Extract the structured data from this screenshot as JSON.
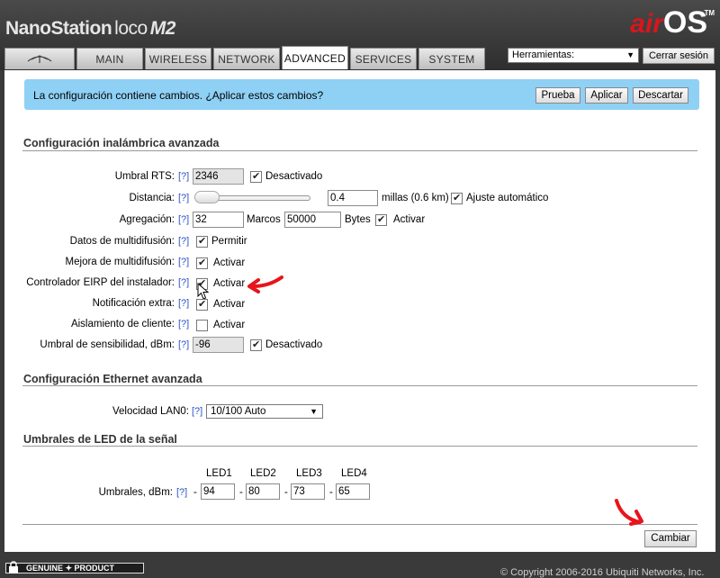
{
  "header": {
    "brand_main": "NanoStation",
    "brand_sub": "loco",
    "brand_model": "M2",
    "logo_air": "air",
    "logo_os": "OS",
    "logo_tm": "TM"
  },
  "tabs": [
    {
      "label": "",
      "icon": "ubiquiti-logo-icon"
    },
    {
      "label": "MAIN"
    },
    {
      "label": "WIRELESS"
    },
    {
      "label": "NETWORK"
    },
    {
      "label": "ADVANCED",
      "active": true
    },
    {
      "label": "SERVICES"
    },
    {
      "label": "SYSTEM"
    }
  ],
  "tools": {
    "selected": "Herramientas:",
    "logout": "Cerrar sesión"
  },
  "notice": {
    "message": "La configuración contiene cambios. ¿Aplicar estos cambios?",
    "test": "Prueba",
    "apply": "Aplicar",
    "discard": "Descartar"
  },
  "wireless": {
    "title": "Configuración inalámbrica avanzada",
    "help": "[?]",
    "rts": {
      "label": "Umbral RTS:",
      "value": "2346",
      "cb_label": "Desactivado"
    },
    "distance": {
      "label": "Distancia:",
      "value": "0.4",
      "unit": "millas (0.6 km)",
      "cb_label": "Ajuste automático"
    },
    "aggregation": {
      "label": "Agregación:",
      "frames": "32",
      "frames_unit": "Marcos",
      "bytes": "50000",
      "bytes_unit": "Bytes",
      "cb_label": "Activar"
    },
    "multicast": {
      "label": "Datos de multidifusión:",
      "cb_label": "Permitir"
    },
    "multicast_enh": {
      "label": "Mejora de multidifusión:",
      "cb_label": "Activar"
    },
    "eirp": {
      "label": "Controlador EIRP del instalador:",
      "cb_label": "Activar"
    },
    "extra_report": {
      "label": "Notificación extra:",
      "cb_label": "Activar"
    },
    "client_iso": {
      "label": "Aislamiento de cliente:",
      "cb_label": "Activar"
    },
    "sensitivity": {
      "label": "Umbral de sensibilidad, dBm:",
      "value": "-96",
      "cb_label": "Desactivado"
    }
  },
  "ethernet": {
    "title": "Configuración Ethernet avanzada",
    "lan_label": "Velocidad LAN0:",
    "lan_value": "10/100 Auto"
  },
  "led": {
    "title": "Umbrales de LED de la señal",
    "headers": [
      "LED1",
      "LED2",
      "LED3",
      "LED4"
    ],
    "label": "Umbrales, dBm:",
    "dash": "-",
    "values": [
      "94",
      "80",
      "73",
      "65"
    ]
  },
  "change_button": "Cambiar",
  "footer": {
    "badge": "GENUINE ✦ PRODUCT",
    "copyright": "© Copyright 2006-2016 Ubiquiti Networks, Inc."
  },
  "colors": {
    "notice_bg": "#8fd0f5",
    "logo_red": "#d9161c",
    "annotation_red": "#e8141b"
  }
}
